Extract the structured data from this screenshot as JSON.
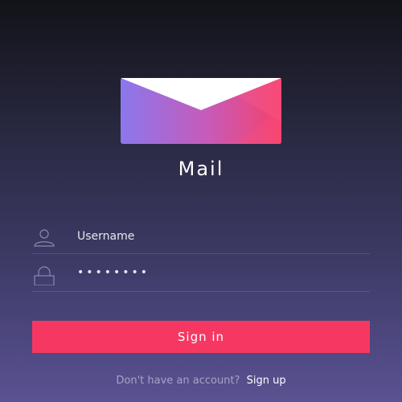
{
  "app": {
    "title": "Mail",
    "logo_icon": "envelope-icon"
  },
  "login_form": {
    "username_value": "Username",
    "username_icon": "user-icon",
    "password_value": "••••••••",
    "password_icon": "lock-icon",
    "submit_label": "Sign in"
  },
  "footer": {
    "prompt": "Don't have an account?",
    "signup_label": "Sign up"
  },
  "colors": {
    "accent": "#f63762",
    "background_top": "#121219",
    "background_bottom": "#5a5292"
  }
}
